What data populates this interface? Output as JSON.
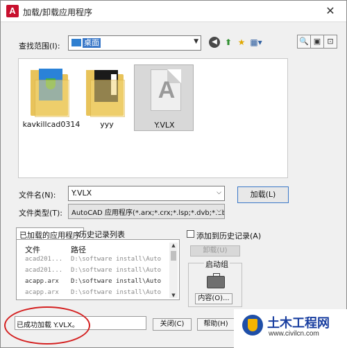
{
  "window": {
    "title": "加载/卸载应用程序",
    "app_icon_letter": "A"
  },
  "lookin": {
    "label": "查找范围(I):",
    "value": "桌面"
  },
  "files": [
    {
      "name": "kavkillcad0314",
      "type": "folder"
    },
    {
      "name": "yyy",
      "type": "folder"
    },
    {
      "name": "Y.VLX",
      "type": "vlx",
      "selected": true
    }
  ],
  "filename": {
    "label": "文件名(N):",
    "value": "Y.VLX"
  },
  "filetype": {
    "label": "文件类型(T):",
    "value": "AutoCAD 应用程序(*.arx;*.crx;*.lsp;*.dvb;*.dbx"
  },
  "buttons": {
    "load": "加载(L)",
    "unload": "卸载(U)",
    "contents": "内容(O)...",
    "close": "关闭(C)",
    "help": "帮助(H)"
  },
  "tabs": {
    "loaded": "已加载的应用程序",
    "history": "历史记录列表"
  },
  "list": {
    "col_file": "文件",
    "col_path": "路径",
    "rows": [
      {
        "file": "acad201...",
        "path": "D:\\software install\\Auto",
        "dim": true
      },
      {
        "file": "acad201...",
        "path": "D:\\software install\\Auto",
        "dim": true
      },
      {
        "file": "acapp.arx",
        "path": "D:\\software install\\Auto",
        "dim": false
      },
      {
        "file": "acapp.arx",
        "path": "D:\\software install\\Auto",
        "dim": true
      }
    ]
  },
  "options": {
    "add_history": "添加到历史记录(A)",
    "startup_group": "启动组"
  },
  "status": {
    "message": "已成功加载 Y.VLX。"
  },
  "watermark": {
    "title": "土木工程网",
    "url": "www.civilcn.com"
  },
  "colors": {
    "accent": "#3a78c8",
    "annotation": "#d42020",
    "brand_red": "#c8102e"
  }
}
